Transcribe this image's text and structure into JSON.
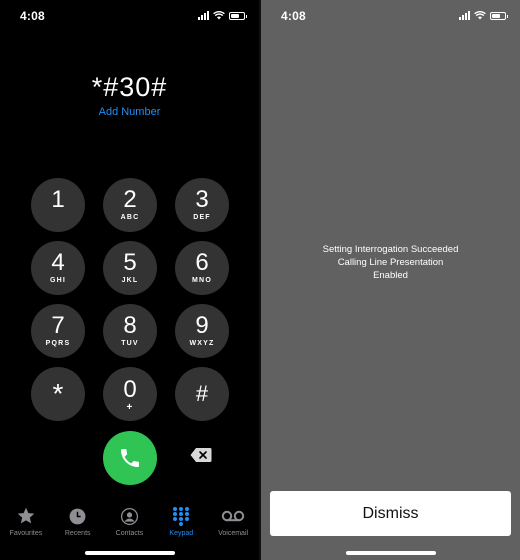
{
  "left_screen": {
    "status": {
      "time": "4:08"
    },
    "dialed_number": "*#30#",
    "add_number": "Add Number",
    "keys": [
      {
        "digit": "1",
        "letters": ""
      },
      {
        "digit": "2",
        "letters": "ABC"
      },
      {
        "digit": "3",
        "letters": "DEF"
      },
      {
        "digit": "4",
        "letters": "GHI"
      },
      {
        "digit": "5",
        "letters": "JKL"
      },
      {
        "digit": "6",
        "letters": "MNO"
      },
      {
        "digit": "7",
        "letters": "PQRS"
      },
      {
        "digit": "8",
        "letters": "TUV"
      },
      {
        "digit": "9",
        "letters": "WXYZ"
      },
      {
        "digit": "*",
        "letters": ""
      },
      {
        "digit": "0",
        "letters": "+"
      },
      {
        "digit": "#",
        "letters": ""
      }
    ],
    "tabs": [
      {
        "label": "Favourites",
        "icon": "star-icon",
        "active": false
      },
      {
        "label": "Recents",
        "icon": "clock-icon",
        "active": false
      },
      {
        "label": "Contacts",
        "icon": "person-icon",
        "active": false
      },
      {
        "label": "Keypad",
        "icon": "keypad-icon",
        "active": true
      },
      {
        "label": "Voicemail",
        "icon": "voicemail-icon",
        "active": false
      }
    ]
  },
  "right_screen": {
    "status": {
      "time": "4:08"
    },
    "message_line1": "Setting Interrogation Succeeded",
    "message_line2": "Calling Line Presentation",
    "message_line3": "Enabled",
    "dismiss_label": "Dismiss"
  },
  "colors": {
    "accent_blue": "#1f8ef5",
    "call_green": "#30c454",
    "key_gray": "#333333",
    "alert_background": "#616161"
  }
}
